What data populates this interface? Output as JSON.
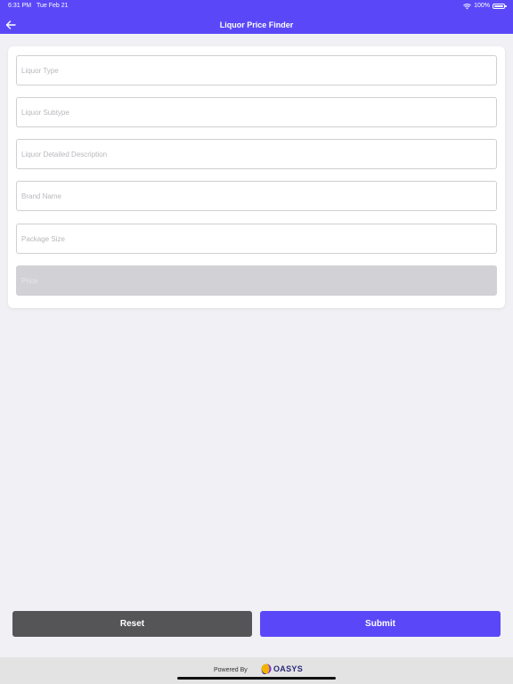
{
  "status_bar": {
    "time": "6:31 PM",
    "date": "Tue Feb 21",
    "battery": "100%"
  },
  "nav": {
    "title": "Liquor Price Finder"
  },
  "form": {
    "fields": [
      {
        "placeholder": "Liquor Type"
      },
      {
        "placeholder": "Liquor Subtype"
      },
      {
        "placeholder": "Liquor Detailed Description"
      },
      {
        "placeholder": "Brand Name"
      },
      {
        "placeholder": "Package Size"
      },
      {
        "placeholder": "Price"
      }
    ]
  },
  "actions": {
    "reset_label": "Reset",
    "submit_label": "Submit"
  },
  "footer": {
    "powered_by": "Powered By",
    "brand": "OASYS"
  },
  "colors": {
    "accent": "#5a48f8",
    "reset": "#555557",
    "background": "#f1f0f5"
  }
}
